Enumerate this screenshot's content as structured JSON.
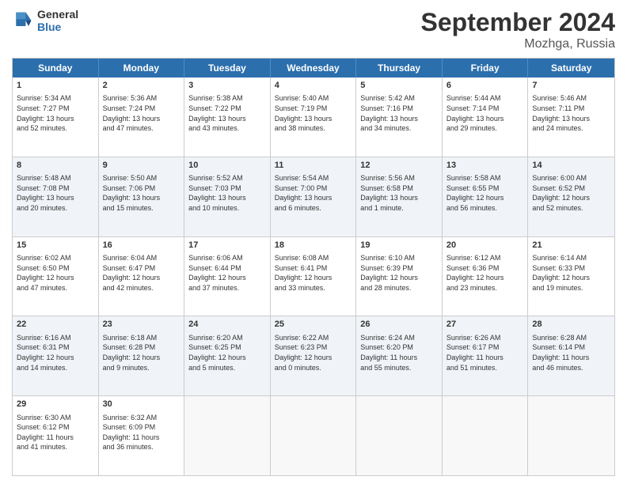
{
  "header": {
    "logo_line1": "General",
    "logo_line2": "Blue",
    "month_title": "September 2024",
    "location": "Mozhga, Russia"
  },
  "weekdays": [
    "Sunday",
    "Monday",
    "Tuesday",
    "Wednesday",
    "Thursday",
    "Friday",
    "Saturday"
  ],
  "rows": [
    [
      {
        "day": "1",
        "info": "Sunrise: 5:34 AM\nSunset: 7:27 PM\nDaylight: 13 hours\nand 52 minutes."
      },
      {
        "day": "2",
        "info": "Sunrise: 5:36 AM\nSunset: 7:24 PM\nDaylight: 13 hours\nand 47 minutes."
      },
      {
        "day": "3",
        "info": "Sunrise: 5:38 AM\nSunset: 7:22 PM\nDaylight: 13 hours\nand 43 minutes."
      },
      {
        "day": "4",
        "info": "Sunrise: 5:40 AM\nSunset: 7:19 PM\nDaylight: 13 hours\nand 38 minutes."
      },
      {
        "day": "5",
        "info": "Sunrise: 5:42 AM\nSunset: 7:16 PM\nDaylight: 13 hours\nand 34 minutes."
      },
      {
        "day": "6",
        "info": "Sunrise: 5:44 AM\nSunset: 7:14 PM\nDaylight: 13 hours\nand 29 minutes."
      },
      {
        "day": "7",
        "info": "Sunrise: 5:46 AM\nSunset: 7:11 PM\nDaylight: 13 hours\nand 24 minutes."
      }
    ],
    [
      {
        "day": "8",
        "info": "Sunrise: 5:48 AM\nSunset: 7:08 PM\nDaylight: 13 hours\nand 20 minutes."
      },
      {
        "day": "9",
        "info": "Sunrise: 5:50 AM\nSunset: 7:06 PM\nDaylight: 13 hours\nand 15 minutes."
      },
      {
        "day": "10",
        "info": "Sunrise: 5:52 AM\nSunset: 7:03 PM\nDaylight: 13 hours\nand 10 minutes."
      },
      {
        "day": "11",
        "info": "Sunrise: 5:54 AM\nSunset: 7:00 PM\nDaylight: 13 hours\nand 6 minutes."
      },
      {
        "day": "12",
        "info": "Sunrise: 5:56 AM\nSunset: 6:58 PM\nDaylight: 13 hours\nand 1 minute."
      },
      {
        "day": "13",
        "info": "Sunrise: 5:58 AM\nSunset: 6:55 PM\nDaylight: 12 hours\nand 56 minutes."
      },
      {
        "day": "14",
        "info": "Sunrise: 6:00 AM\nSunset: 6:52 PM\nDaylight: 12 hours\nand 52 minutes."
      }
    ],
    [
      {
        "day": "15",
        "info": "Sunrise: 6:02 AM\nSunset: 6:50 PM\nDaylight: 12 hours\nand 47 minutes."
      },
      {
        "day": "16",
        "info": "Sunrise: 6:04 AM\nSunset: 6:47 PM\nDaylight: 12 hours\nand 42 minutes."
      },
      {
        "day": "17",
        "info": "Sunrise: 6:06 AM\nSunset: 6:44 PM\nDaylight: 12 hours\nand 37 minutes."
      },
      {
        "day": "18",
        "info": "Sunrise: 6:08 AM\nSunset: 6:41 PM\nDaylight: 12 hours\nand 33 minutes."
      },
      {
        "day": "19",
        "info": "Sunrise: 6:10 AM\nSunset: 6:39 PM\nDaylight: 12 hours\nand 28 minutes."
      },
      {
        "day": "20",
        "info": "Sunrise: 6:12 AM\nSunset: 6:36 PM\nDaylight: 12 hours\nand 23 minutes."
      },
      {
        "day": "21",
        "info": "Sunrise: 6:14 AM\nSunset: 6:33 PM\nDaylight: 12 hours\nand 19 minutes."
      }
    ],
    [
      {
        "day": "22",
        "info": "Sunrise: 6:16 AM\nSunset: 6:31 PM\nDaylight: 12 hours\nand 14 minutes."
      },
      {
        "day": "23",
        "info": "Sunrise: 6:18 AM\nSunset: 6:28 PM\nDaylight: 12 hours\nand 9 minutes."
      },
      {
        "day": "24",
        "info": "Sunrise: 6:20 AM\nSunset: 6:25 PM\nDaylight: 12 hours\nand 5 minutes."
      },
      {
        "day": "25",
        "info": "Sunrise: 6:22 AM\nSunset: 6:23 PM\nDaylight: 12 hours\nand 0 minutes."
      },
      {
        "day": "26",
        "info": "Sunrise: 6:24 AM\nSunset: 6:20 PM\nDaylight: 11 hours\nand 55 minutes."
      },
      {
        "day": "27",
        "info": "Sunrise: 6:26 AM\nSunset: 6:17 PM\nDaylight: 11 hours\nand 51 minutes."
      },
      {
        "day": "28",
        "info": "Sunrise: 6:28 AM\nSunset: 6:14 PM\nDaylight: 11 hours\nand 46 minutes."
      }
    ],
    [
      {
        "day": "29",
        "info": "Sunrise: 6:30 AM\nSunset: 6:12 PM\nDaylight: 11 hours\nand 41 minutes."
      },
      {
        "day": "30",
        "info": "Sunrise: 6:32 AM\nSunset: 6:09 PM\nDaylight: 11 hours\nand 36 minutes."
      },
      {
        "day": "",
        "info": ""
      },
      {
        "day": "",
        "info": ""
      },
      {
        "day": "",
        "info": ""
      },
      {
        "day": "",
        "info": ""
      },
      {
        "day": "",
        "info": ""
      }
    ]
  ]
}
